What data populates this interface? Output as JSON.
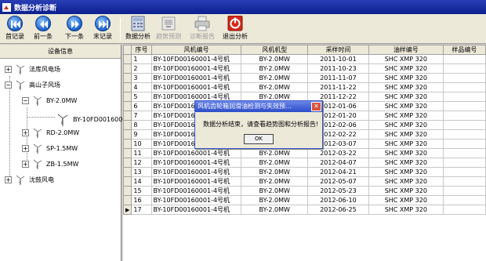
{
  "window": {
    "title": "数据分析诊断"
  },
  "toolbar": {
    "buttons": [
      {
        "label": "首记录"
      },
      {
        "label": "前一条"
      },
      {
        "label": "下一条"
      },
      {
        "label": "末记录"
      },
      {
        "label": "数据分析"
      },
      {
        "label": "趋势预测"
      },
      {
        "label": "诊断报告"
      },
      {
        "label": "退出分析"
      }
    ]
  },
  "tree": {
    "header": "设备信息",
    "nodes": [
      {
        "label": "法库风电场",
        "expander": "+"
      },
      {
        "label": "高山子风场",
        "expander": "−"
      },
      {
        "label": "BY-2.0MW",
        "expander": "−"
      },
      {
        "label": "BY-10FD0016000"
      },
      {
        "label": "RD-2.0MW",
        "expander": "+"
      },
      {
        "label": "SP-1.5MW",
        "expander": "+"
      },
      {
        "label": "ZB-1.5MW",
        "expander": "+"
      },
      {
        "label": "沈鼓风电",
        "expander": "+"
      }
    ]
  },
  "grid": {
    "columns": [
      "序号",
      "风机编号",
      "风机机型",
      "采样时间",
      "油样编号",
      "样品编号"
    ],
    "rows": [
      [
        "1",
        "BY-10FD00160001-4号机",
        "BY-2.0MW",
        "2011-10-01",
        "SHC XMP 320",
        ""
      ],
      [
        "2",
        "BY-10FD00160001-4号机",
        "BY-2.0MW",
        "2011-10-23",
        "SHC XMP 320",
        ""
      ],
      [
        "3",
        "BY-10FD00160001-4号机",
        "BY-2.0MW",
        "2011-11-07",
        "SHC XMP 320",
        ""
      ],
      [
        "4",
        "BY-10FD00160001-4号机",
        "BY-2.0MW",
        "2011-11-22",
        "SHC XMP 320",
        ""
      ],
      [
        "5",
        "BY-10FD00160001-4号机",
        "BY-2.0MW",
        "2011-12-22",
        "SHC XMP 320",
        ""
      ],
      [
        "6",
        "BY-10FD00160001-4号机",
        "BY-2.0MW",
        "2012-01-06",
        "SHC XMP 320",
        ""
      ],
      [
        "7",
        "BY-10FD00160001-4号机",
        "BY-2.0MW",
        "2012-01-20",
        "SHC XMP 320",
        ""
      ],
      [
        "8",
        "BY-10FD00160001-4号机",
        "BY-2.0MW",
        "2012-02-06",
        "SHC XMP 320",
        ""
      ],
      [
        "9",
        "BY-10FD00160001-4号机",
        "BY-2.0MW",
        "2012-02-22",
        "SHC XMP 320",
        ""
      ],
      [
        "10",
        "BY-10FD00160001-4号机",
        "BY-2.0MW",
        "2012-03-07",
        "SHC XMP 320",
        ""
      ],
      [
        "11",
        "BY-10FD00160001-4号机",
        "BY-2.0MW",
        "2012-03-22",
        "SHC XMP 320",
        ""
      ],
      [
        "12",
        "BY-10FD00160001-4号机",
        "BY-2.0MW",
        "2012-04-07",
        "SHC XMP 320",
        ""
      ],
      [
        "13",
        "BY-10FD00160001-4号机",
        "BY-2.0MW",
        "2012-04-21",
        "SHC XMP 320",
        ""
      ],
      [
        "14",
        "BY-10FD00160001-4号机",
        "BY-2.0MW",
        "2012-05-07",
        "SHC XMP 320",
        ""
      ],
      [
        "15",
        "BY-10FD00160001-4号机",
        "BY-2.0MW",
        "2012-05-23",
        "SHC XMP 320",
        ""
      ],
      [
        "16",
        "BY-10FD00160001-4号机",
        "BY-2.0MW",
        "2012-06-10",
        "SHC XMP 320",
        ""
      ],
      [
        "17",
        "BY-10FD00160001-4号机",
        "BY-2.0MW",
        "2012-06-25",
        "SHC XMP 320",
        ""
      ]
    ],
    "current_row_marker": "▶"
  },
  "dialog": {
    "title": "风机齿轮箱润滑油检测与失效预...",
    "message": "数据分析结束，请查看趋势图和分析报告!",
    "ok_label": "OK",
    "close_label": "✕"
  },
  "colors": {
    "titlebar": "#0b1f8f",
    "dialog_title": "#2c4cc8",
    "exit_icon": "#d42a1a"
  }
}
